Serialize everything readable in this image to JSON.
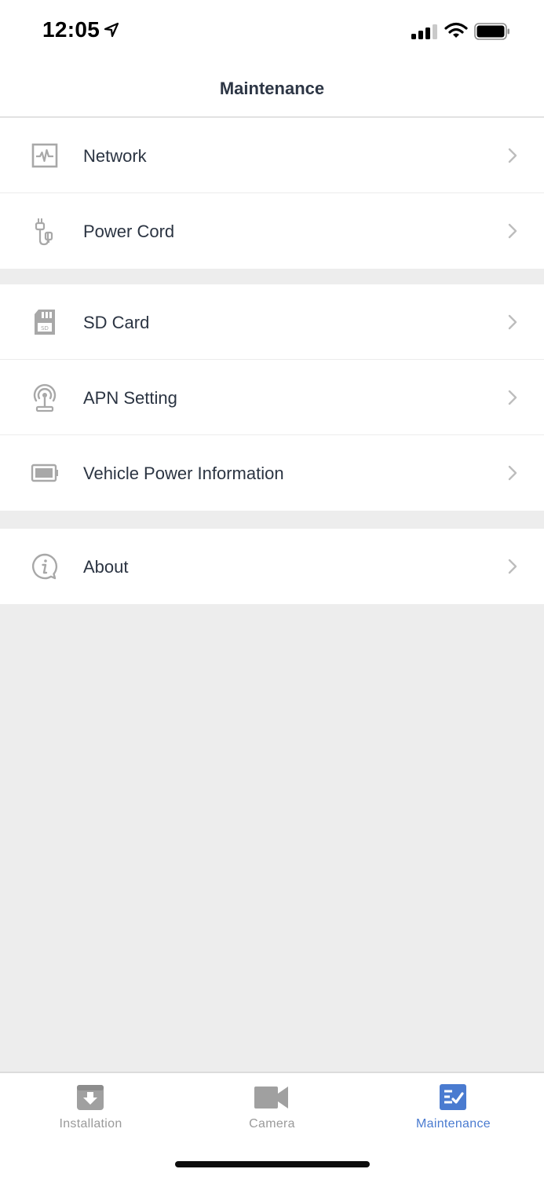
{
  "status": {
    "time": "12:05"
  },
  "header": {
    "title": "Maintenance"
  },
  "menu": {
    "group1": [
      {
        "label": "Network",
        "icon": "network-monitor-icon"
      },
      {
        "label": "Power Cord",
        "icon": "power-cord-icon"
      }
    ],
    "group2": [
      {
        "label": "SD Card",
        "icon": "sd-card-icon"
      },
      {
        "label": "APN Setting",
        "icon": "apn-antenna-icon"
      },
      {
        "label": "Vehicle Power Information",
        "icon": "battery-icon"
      }
    ],
    "group3": [
      {
        "label": "About",
        "icon": "info-icon"
      }
    ]
  },
  "tabs": [
    {
      "label": "Installation",
      "icon": "installation-box-icon",
      "active": false
    },
    {
      "label": "Camera",
      "icon": "video-camera-icon",
      "active": false
    },
    {
      "label": "Maintenance",
      "icon": "checklist-icon",
      "active": true
    }
  ],
  "colors": {
    "accent": "#4a7bd0",
    "text": "#2b3442",
    "inactive_tab": "#9a9a9a",
    "background": "#ededed"
  }
}
